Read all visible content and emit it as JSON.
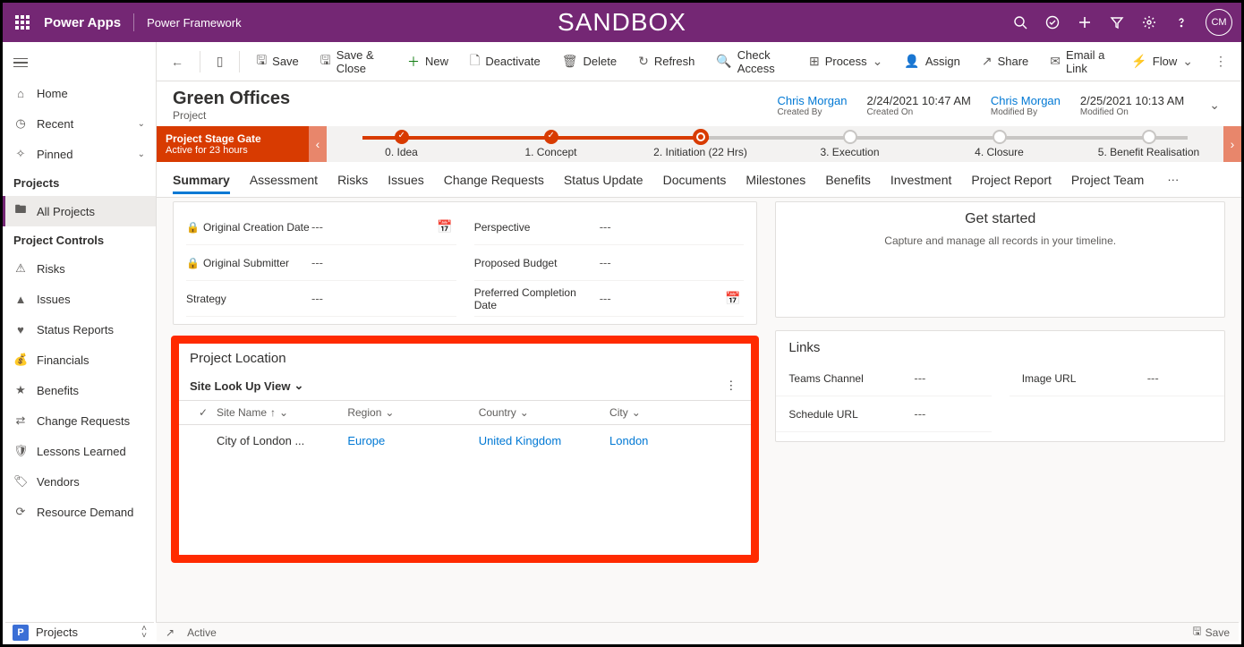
{
  "header": {
    "app_name": "Power Apps",
    "framework": "Power Framework",
    "env_banner": "SANDBOX",
    "avatar_initials": "CM"
  },
  "sidebar": {
    "nav": [
      {
        "icon": "⌂",
        "label": "Home"
      },
      {
        "icon": "◷",
        "label": "Recent",
        "chevron": true
      },
      {
        "icon": "✧",
        "label": "Pinned",
        "chevron": true
      }
    ],
    "groups": [
      {
        "name": "Projects",
        "items": [
          {
            "icon": "🖿",
            "label": "All Projects",
            "active": true
          }
        ]
      },
      {
        "name": "Project Controls",
        "items": [
          {
            "icon": "⚠",
            "label": "Risks"
          },
          {
            "icon": "▲",
            "label": "Issues"
          },
          {
            "icon": "♥",
            "label": "Status Reports"
          },
          {
            "icon": "💰",
            "label": "Financials"
          },
          {
            "icon": "★",
            "label": "Benefits"
          },
          {
            "icon": "⇄",
            "label": "Change Requests"
          },
          {
            "icon": "🛡",
            "label": "Lessons Learned"
          },
          {
            "icon": "🏷",
            "label": "Vendors"
          },
          {
            "icon": "⟳",
            "label": "Resource Demand"
          }
        ]
      }
    ],
    "area_switcher": {
      "badge": "P",
      "label": "Projects"
    }
  },
  "commandbar": {
    "save": "Save",
    "save_close": "Save & Close",
    "new": "New",
    "deactivate": "Deactivate",
    "delete": "Delete",
    "refresh": "Refresh",
    "check_access": "Check Access",
    "process": "Process",
    "assign": "Assign",
    "share": "Share",
    "email_link": "Email a Link",
    "flow": "Flow"
  },
  "record": {
    "title": "Green Offices",
    "entity": "Project",
    "meta": [
      {
        "value": "Chris Morgan",
        "label": "Created By",
        "link": true
      },
      {
        "value": "2/24/2021 10:47 AM",
        "label": "Created On"
      },
      {
        "value": "Chris Morgan",
        "label": "Modified By",
        "link": true
      },
      {
        "value": "2/25/2021 10:13 AM",
        "label": "Modified On"
      }
    ]
  },
  "bpf": {
    "banner_title": "Project Stage Gate",
    "banner_sub": "Active for 23 hours",
    "stages": [
      {
        "label": "0. Idea",
        "state": "done"
      },
      {
        "label": "1. Concept",
        "state": "done"
      },
      {
        "label": "2. Initiation  (22 Hrs)",
        "state": "current"
      },
      {
        "label": "3. Execution",
        "state": "future"
      },
      {
        "label": "4. Closure",
        "state": "future"
      },
      {
        "label": "5. Benefit Realisation",
        "state": "future"
      }
    ]
  },
  "tabs": [
    "Summary",
    "Assessment",
    "Risks",
    "Issues",
    "Change Requests",
    "Status Update",
    "Documents",
    "Milestones",
    "Benefits",
    "Investment",
    "Project Report",
    "Project Team"
  ],
  "active_tab": "Summary",
  "form_fields_left": [
    {
      "label": "Original Creation Date",
      "value": "---",
      "lock": true,
      "cal": true
    },
    {
      "label": "Original Submitter",
      "value": "---",
      "lock": true
    },
    {
      "label": "Strategy",
      "value": "---"
    }
  ],
  "form_fields_right": [
    {
      "label": "Perspective",
      "value": "---"
    },
    {
      "label": "Proposed Budget",
      "value": "---"
    },
    {
      "label": "Preferred Completion Date",
      "value": "---",
      "cal": true
    }
  ],
  "timeline": {
    "title": "Get started",
    "sub": "Capture and manage all records in your timeline."
  },
  "location": {
    "section_title": "Project Location",
    "view_name": "Site Look Up View",
    "columns": [
      "Site Name",
      "Region",
      "Country",
      "City"
    ],
    "rows": [
      {
        "site": "City of London ...",
        "region": "Europe",
        "country": "United Kingdom",
        "city": "London"
      }
    ]
  },
  "links": {
    "title": "Links",
    "fields": [
      {
        "label": "Teams Channel",
        "value": "---"
      },
      {
        "label": "Image URL",
        "value": "---"
      },
      {
        "label": "Schedule URL",
        "value": "---"
      }
    ]
  },
  "footer": {
    "status": "Active",
    "save": "Save"
  }
}
